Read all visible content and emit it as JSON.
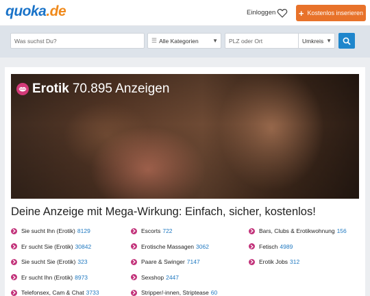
{
  "header": {
    "logo_part1": "quoka",
    "logo_part2": ".de",
    "login_label": "Einloggen",
    "post_button_label": "Kostenlos inserieren",
    "accent_color": "#e8722a"
  },
  "search": {
    "what_placeholder": "Was suchst Du?",
    "category_value": "Alle Kategorien",
    "location_placeholder": "PLZ oder Ort",
    "radius_value": "Umkreis"
  },
  "hero": {
    "category": "Erotik",
    "count": "70.895 Anzeigen"
  },
  "headline": "Deine Anzeige mit Mega-Wirkung: Einfach, sicher, kostenlos!",
  "subcategories": [
    [
      {
        "label": "Sie sucht Ihn (Erotik)",
        "count": "8129"
      },
      {
        "label": "Er sucht Sie (Erotik)",
        "count": "30842"
      },
      {
        "label": "Sie sucht Sie (Erotik)",
        "count": "323"
      },
      {
        "label": "Er sucht Ihn (Erotik)",
        "count": "8973"
      },
      {
        "label": "Telefonsex, Cam & Chat",
        "count": "3733"
      }
    ],
    [
      {
        "label": "Escorts",
        "count": "722"
      },
      {
        "label": "Erotische Massagen",
        "count": "3062"
      },
      {
        "label": "Paare & Swinger",
        "count": "7147"
      },
      {
        "label": "Sexshop",
        "count": "2447"
      },
      {
        "label": "Stripper/-innen, Striptease",
        "count": "60"
      }
    ],
    [
      {
        "label": "Bars, Clubs & Erotikwohnung",
        "count": "156"
      },
      {
        "label": "Fetisch",
        "count": "4989"
      },
      {
        "label": "Erotik Jobs",
        "count": "312"
      }
    ]
  ]
}
